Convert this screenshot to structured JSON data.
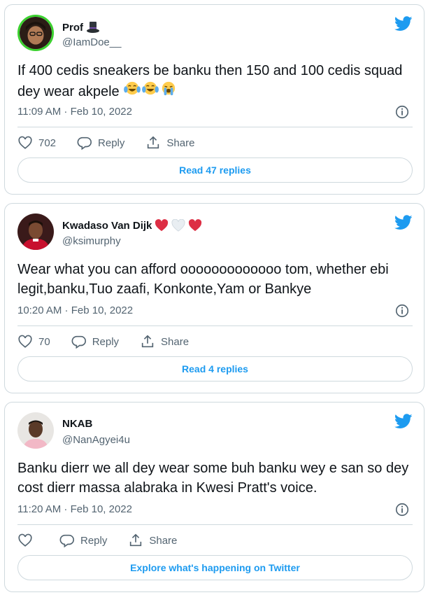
{
  "tweets": [
    {
      "name": "Prof",
      "name_emoji": "top-hat",
      "handle": "@IamDoe__",
      "text": "If 400 cedis sneakers be banku then 150  and 100 cedis squad dey wear akpele",
      "text_emojis": [
        "tears-of-joy",
        "tears-of-joy",
        "loudly-crying"
      ],
      "time": "11:09 AM · Feb 10, 2022",
      "likes": "702",
      "reply_label": "Reply",
      "share_label": "Share",
      "footer_label": "Read 47 replies"
    },
    {
      "name": "Kwadaso Van Dijk",
      "name_emoji": "red-heart white-heart red-heart",
      "handle": "@ksimurphy",
      "text": "Wear what you can afford ooooooooooooo tom, whether ebi legit,banku,Tuo zaafi, Konkonte,Yam or Bankye",
      "time": "10:20 AM · Feb 10, 2022",
      "likes": "70",
      "reply_label": "Reply",
      "share_label": "Share",
      "footer_label": "Read 4 replies"
    },
    {
      "name": "NKAB",
      "handle": "@NanAgyei4u",
      "text": "Banku dierr we all dey wear some buh banku wey e san so dey cost dierr massa alabraka in Kwesi Pratt's voice.",
      "time": "11:20 AM · Feb 10, 2022",
      "likes": "",
      "reply_label": "Reply",
      "share_label": "Share",
      "footer_label": "Explore what's happening on Twitter"
    }
  ],
  "colors": {
    "accent": "#1d9bf0",
    "secondary_text": "#536471",
    "border": "#cfd9de",
    "avatar_ring": "#3bd12f",
    "heart_red": "#e0245e"
  },
  "icons": [
    "twitter-bird-icon",
    "info-icon",
    "heart-icon",
    "reply-icon",
    "share-icon"
  ]
}
